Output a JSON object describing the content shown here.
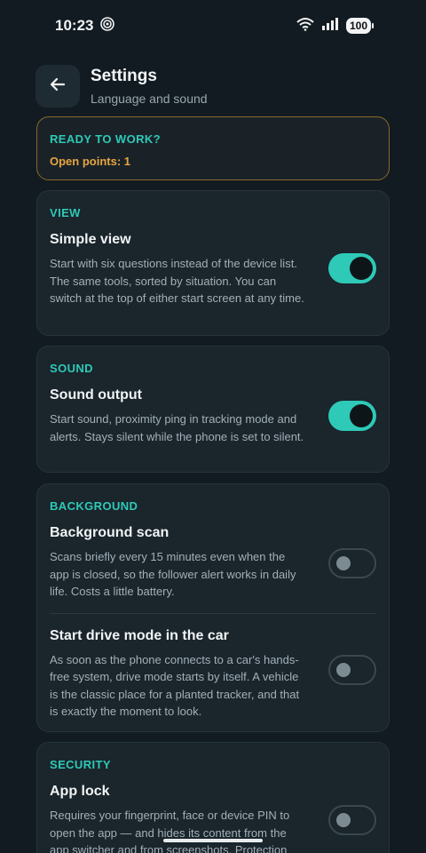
{
  "status_bar": {
    "time": "10:23",
    "battery": "100",
    "icons": [
      "app-status-icon",
      "wifi-icon",
      "signal-icon",
      "battery-icon"
    ]
  },
  "header": {
    "title": "Settings",
    "subtitle": "Language and sound",
    "back_icon": "arrow-left-icon"
  },
  "ready": {
    "title": "READY TO WORK?",
    "open_points": "Open points: 1"
  },
  "view": {
    "label": "VIEW",
    "simple_view": {
      "title": "Simple view",
      "desc": "Start with six questions instead of the device list. The same tools, sorted by situation. You can switch at the top of either start screen at any time.",
      "enabled": true
    }
  },
  "sound": {
    "label": "SOUND",
    "sound_output": {
      "title": "Sound output",
      "desc": "Start sound, proximity ping in tracking mode and alerts. Stays silent while the phone is set to silent.",
      "enabled": true
    }
  },
  "background": {
    "label": "BACKGROUND",
    "background_scan": {
      "title": "Background scan",
      "desc": "Scans briefly every 15 minutes even when the app is closed, so the follower alert works in daily life. Costs a little battery.",
      "enabled": false
    },
    "drive_mode": {
      "title": "Start drive mode in the car",
      "desc": "As soon as the phone connects to a car's hands-free system, drive mode starts by itself. A vehicle is the classic place for a planted tracker, and that is exactly the moment to look.",
      "enabled": false
    }
  },
  "security": {
    "label": "SECURITY",
    "app_lock": {
      "title": "App lock",
      "desc": "Requires your fingerprint, face or device PIN to open the app — and hides its content from the app switcher and from screenshots. Protection",
      "enabled": false
    }
  },
  "colors": {
    "background": "#121b21",
    "card": "#1a252c",
    "accent": "#2ec9b7",
    "warning": "#e6a540"
  }
}
